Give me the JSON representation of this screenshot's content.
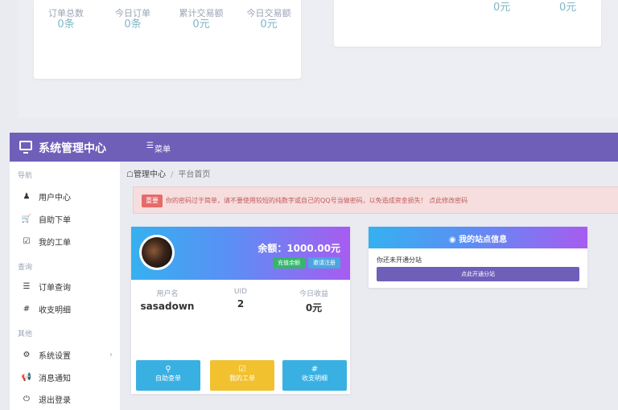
{
  "top_stats": {
    "left": [
      {
        "label": "订单总数",
        "value": "0条"
      },
      {
        "label": "今日订单",
        "value": "0条"
      },
      {
        "label": "累计交易额",
        "value": "0元"
      },
      {
        "label": "今日交易额",
        "value": "0元"
      }
    ],
    "right": [
      {
        "value": "0元"
      },
      {
        "value": "0元"
      }
    ]
  },
  "header": {
    "title": "系统管理中心",
    "menu_label": "菜单",
    "menu_icon": "menu-icon"
  },
  "sidebar": {
    "sections": [
      {
        "title": "导航",
        "items": [
          {
            "label": "用户中心",
            "icon": "user-icon"
          },
          {
            "label": "自助下单",
            "icon": "cart-icon"
          },
          {
            "label": "我的工单",
            "icon": "checkbox-icon"
          }
        ]
      },
      {
        "title": "查询",
        "items": [
          {
            "label": "订单查询",
            "icon": "list-icon"
          },
          {
            "label": "收支明细",
            "icon": "hash-icon"
          }
        ]
      },
      {
        "title": "其他",
        "items": [
          {
            "label": "系统设置",
            "icon": "settings-icon"
          },
          {
            "label": "消息通知",
            "icon": "bullhorn-icon"
          },
          {
            "label": "退出登录",
            "icon": "power-icon"
          }
        ]
      }
    ]
  },
  "breadcrumb": {
    "home": "管理中心",
    "current": "平台首页"
  },
  "alert": {
    "badge": "重要",
    "message": "你的密码过于简单，请不要使用较短的纯数字或自己的QQ号当做密码，以免造成资金损失！ 点此修改密码"
  },
  "user_card": {
    "balance": "余额：1000.00元",
    "btn_recharge": "充值余额",
    "btn_invite": "邀请注册",
    "stats": [
      {
        "label": "用户名",
        "value": "sasadown"
      },
      {
        "label": "UID",
        "value": "2"
      },
      {
        "label": "今日收益",
        "value": "0元"
      }
    ],
    "quick_buttons": [
      {
        "label": "自助查单",
        "icon": "search-icon",
        "color": "#39b0e2"
      },
      {
        "label": "我的工单",
        "icon": "checkbox-icon",
        "color": "#f1c12f"
      },
      {
        "label": "收支明细",
        "icon": "hash-icon",
        "color": "#39b0e2"
      }
    ]
  },
  "site_card": {
    "title": "我的站点信息",
    "text": "你还未开通分站",
    "button": "点此开通分站"
  },
  "colors": {
    "header": "#6f5fb9",
    "alert_bg": "#f6dede",
    "badge": "#e56a6a"
  }
}
